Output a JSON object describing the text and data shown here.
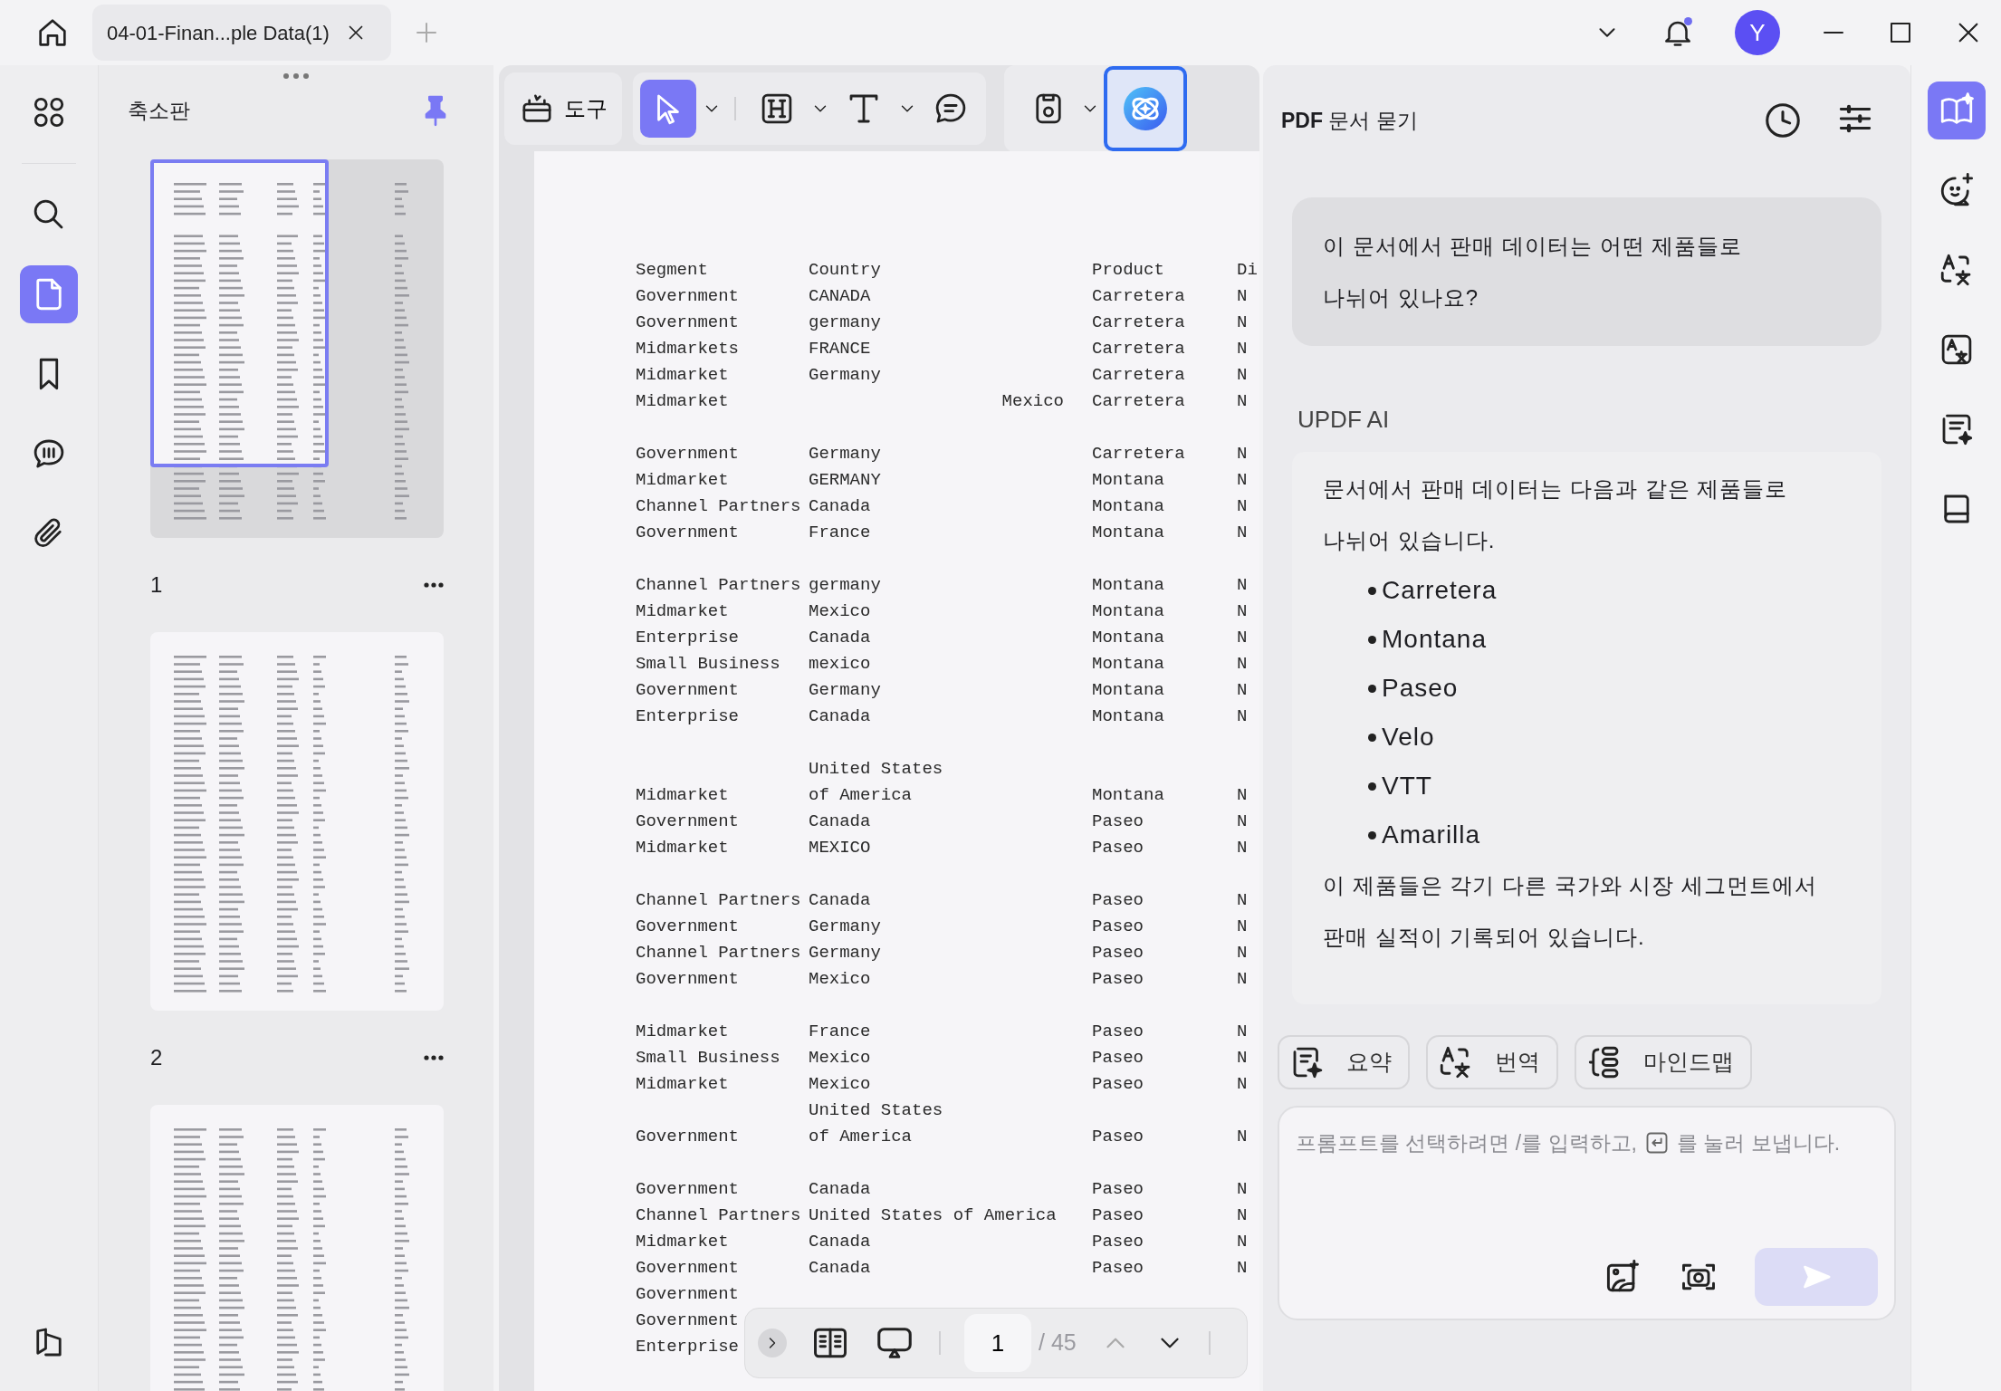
{
  "title_bar": {
    "tab": {
      "title": "04-01-Finan...ple Data(1)",
      "selected": true
    },
    "notification_dot": true,
    "avatar": "Y"
  },
  "left_rail": {
    "items": [
      {
        "kind": "grid",
        "selected": false
      },
      {
        "kind": "search",
        "selected": false
      },
      {
        "kind": "pages",
        "selected": true
      },
      {
        "kind": "bookmark",
        "selected": false
      },
      {
        "kind": "comments",
        "selected": false
      },
      {
        "kind": "attachment",
        "selected": false
      },
      {
        "kind": "layers",
        "selected": false
      }
    ]
  },
  "thumbnails": {
    "title": "축소판",
    "pinned": true,
    "pages": [
      {
        "label": "1",
        "selected": true
      },
      {
        "label": "2",
        "selected": false
      },
      {
        "selected": false
      }
    ]
  },
  "toolbar": {
    "tools_label": "도구",
    "tools": [
      {
        "kind": "select",
        "selected": true,
        "dropdown": true
      },
      {
        "kind": "highlight",
        "selected": false,
        "dropdown": true
      },
      {
        "kind": "text",
        "selected": false,
        "dropdown": true
      },
      {
        "kind": "comment",
        "selected": false,
        "dropdown": false
      }
    ],
    "extras": [
      {
        "kind": "save",
        "selected": false,
        "dropdown": true
      },
      {
        "kind": "ai",
        "selected": true,
        "dropdown": false
      }
    ]
  },
  "document": {
    "groups": [
      {
        "rows": [
          {
            "segment": "Segment",
            "country": "Country",
            "product": "Product",
            "column_4": "Di"
          },
          {
            "segment": "Government",
            "country": "CANADA",
            "product": "Carretera",
            "column_4": "N"
          },
          {
            "segment": "Government",
            "country": "germany",
            "product": "Carretera",
            "column_4": "N"
          },
          {
            "segment": "Midmarkets",
            "country": "FRANCE",
            "product": "Carretera",
            "column_4": "N"
          },
          {
            "segment": "Midmarket",
            "country": "Germany",
            "product": "Carretera",
            "column_4": "N"
          },
          {
            "segment": "Midmarket",
            "column_3": "Mexico",
            "product": "Carretera",
            "column_4": "N"
          }
        ]
      },
      {
        "rows": [
          {
            "segment": "Government",
            "country": "Germany",
            "product": "Carretera",
            "column_4": "N"
          },
          {
            "segment": "Midmarket",
            "country": "GERMANY",
            "product": "Montana",
            "column_4": "N"
          },
          {
            "segment": "Channel Partners",
            "country": "Canada",
            "product": "Montana",
            "column_4": "N"
          },
          {
            "segment": "Government",
            "country": "France",
            "product": "Montana",
            "column_4": "N"
          }
        ]
      },
      {
        "rows": [
          {
            "segment": "Channel Partners",
            "country": "germany",
            "product": "Montana",
            "column_4": "N"
          },
          {
            "segment": "Midmarket",
            "country": "Mexico",
            "product": "Montana",
            "column_4": "N"
          },
          {
            "segment": "Enterprise",
            "country": "Canada",
            "product": "Montana",
            "column_4": "N"
          },
          {
            "segment": "Small Business",
            "country": "mexico",
            "product": "Montana",
            "column_4": "N"
          },
          {
            "segment": "Government",
            "country": "Germany",
            "product": "Montana",
            "column_4": "N"
          },
          {
            "segment": "Enterprise",
            "country": "Canada",
            "product": "Montana",
            "column_4": "N"
          }
        ]
      },
      {
        "rows": [
          {
            "country": "United States"
          },
          {
            "segment": "Midmarket",
            "country": "of America",
            "product": "Montana",
            "column_4": "N"
          },
          {
            "segment": "Government",
            "country": "Canada",
            "product": "Paseo",
            "column_4": "N"
          },
          {
            "segment": "Midmarket",
            "country": "MEXICO",
            "product": "Paseo",
            "column_4": "N"
          }
        ]
      },
      {
        "rows": [
          {
            "segment": "Channel Partners",
            "country": "Canada",
            "product": "Paseo",
            "column_4": "N"
          },
          {
            "segment": "Government",
            "country": "Germany",
            "product": "Paseo",
            "column_4": "N"
          },
          {
            "segment": "Channel Partners",
            "country": "Germany",
            "product": "Paseo",
            "column_4": "N"
          },
          {
            "segment": "Government",
            "country": "Mexico",
            "product": "Paseo",
            "column_4": "N"
          }
        ]
      },
      {
        "rows": [
          {
            "segment": "Midmarket",
            "country": "France",
            "product": "Paseo",
            "column_4": "N"
          },
          {
            "segment": "Small Business",
            "country": "Mexico",
            "product": "Paseo",
            "column_4": "N"
          },
          {
            "segment": "Midmarket",
            "country": "Mexico",
            "product": "Paseo",
            "column_4": "N"
          },
          {
            "country": "United States"
          },
          {
            "segment": "Government",
            "country": "of America",
            "product": "Paseo",
            "column_4": "N"
          }
        ]
      },
      {
        "rows": [
          {
            "segment": "Government",
            "country": "Canada",
            "product": "Paseo",
            "column_4": "N"
          },
          {
            "segment": "Channel Partners",
            "country": "United States of America",
            "product": "Paseo",
            "column_4": "N"
          },
          {
            "segment": "Midmarket",
            "country": "Canada",
            "product": "Paseo",
            "column_4": "N"
          },
          {
            "segment": "Government",
            "country": "Canada",
            "product": "Paseo",
            "column_4": "N"
          },
          {
            "segment": "Government"
          },
          {
            "segment": "Government"
          },
          {
            "segment": "Enterprise"
          }
        ]
      }
    ]
  },
  "page_nav": {
    "page": "1",
    "total": "/ 45",
    "previous_disabled": true,
    "next_disabled": false
  },
  "ai_panel": {
    "title": "**PDF** 문서 묻기",
    "question": "이 문서에서 판매 데이터는 어떤 제품들로 나뉘어 있나요?",
    "assistant_name": "UPDF AI",
    "answer": {
      "intro": "문서에서 판매 데이터는 다음과 같은 제품들로 나뉘어 있습니다.",
      "items": [
        "Carretera",
        "Montana",
        "Paseo",
        "Velo",
        "VTT",
        "Amarilla"
      ],
      "outro": "이 제품들은 각기 다른 국가와 시장 세그먼트에서 판매 실적이 기록되어 있습니다."
    },
    "actions": [
      {
        "kind": "summary",
        "label": "요약"
      },
      {
        "kind": "translate",
        "label": "번역"
      },
      {
        "kind": "mindmap",
        "label": "마인드맵"
      }
    ],
    "prompt": {
      "placeholder": {
        "before_key": "프롬프트를 선택하려면 /를 입력하고,",
        "after_key": "를 눌러 보냅니다."
      },
      "send_disabled": true
    }
  },
  "right_rail": {
    "items": [
      {
        "kind": "ask-pdf",
        "selected": true
      },
      {
        "kind": "chat",
        "selected": false
      },
      {
        "kind": "translate",
        "selected": false
      },
      {
        "kind": "translate-box",
        "selected": false
      },
      {
        "kind": "summarize",
        "selected": false
      },
      {
        "kind": "book",
        "selected": false
      }
    ]
  }
}
